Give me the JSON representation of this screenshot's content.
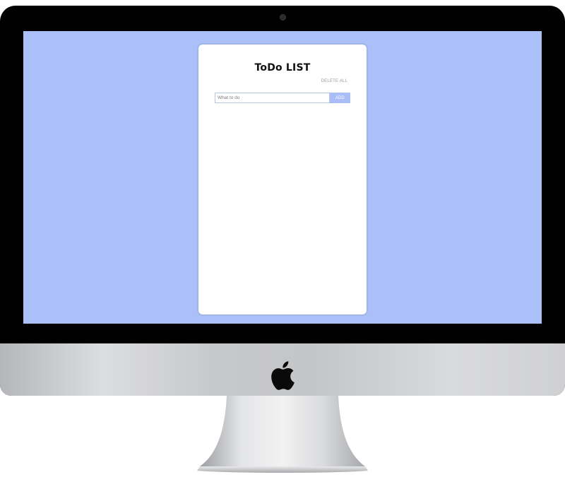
{
  "app": {
    "title": "ToDo LIST",
    "delete_all_label": "DELETE ALL",
    "input": {
      "placeholder": "What to do",
      "value": ""
    },
    "add_label": "ADD",
    "items": []
  },
  "colors": {
    "screen_background": "#abc0f9",
    "card_background": "#ffffff",
    "add_button": "#a9bdf6",
    "input_border": "#b7c6e4",
    "bezel": "#000000",
    "chin": "#cfd0d2"
  },
  "icons": {
    "logo": "apple-logo-icon",
    "camera": "webcam-icon"
  }
}
